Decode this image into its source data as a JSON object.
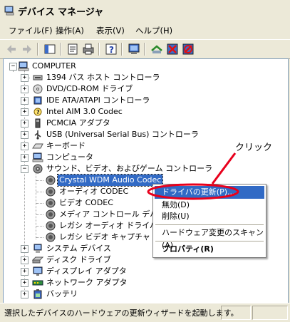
{
  "window": {
    "title": "デバイス マネージャ"
  },
  "menubar": [
    "ファイル(F)",
    "操作(A)",
    "表示(V)",
    "ヘルプ(H)"
  ],
  "toolbar": [
    "back-icon",
    "forward-icon",
    "console-tree-icon",
    "properties-icon",
    "print-icon",
    "help-icon",
    "scan-hardware-icon",
    "update-driver-icon",
    "uninstall-icon",
    "disable-icon"
  ],
  "tree": {
    "root": "COMPUTER",
    "items": [
      {
        "label": "1394 バス ホスト コントローラ",
        "icon": "1394-icon",
        "exp": "+"
      },
      {
        "label": "DVD/CD-ROM ドライブ",
        "icon": "cdrom-icon",
        "exp": "+"
      },
      {
        "label": "IDE ATA/ATAPI コントローラ",
        "icon": "ide-icon",
        "exp": "+"
      },
      {
        "label": "Intel AIM 3.0 Codec",
        "icon": "device-icon",
        "exp": "+"
      },
      {
        "label": "PCMCIA アダプタ",
        "icon": "pcmcia-icon",
        "exp": "+"
      },
      {
        "label": "USB (Universal Serial Bus) コントローラ",
        "icon": "usb-icon",
        "exp": "+"
      },
      {
        "label": "キーボード",
        "icon": "keyboard-icon",
        "exp": "+"
      },
      {
        "label": "コンピュータ",
        "icon": "computer-icon",
        "exp": "+"
      },
      {
        "label": "サウンド、ビデオ、およびゲーム コントローラ",
        "icon": "sound-icon",
        "exp": "-"
      }
    ],
    "sound_children": [
      {
        "label": "Crystal WDM Audio Codec",
        "selected": true
      },
      {
        "label": "オーディオ CODEC"
      },
      {
        "label": "ビデオ CODEC"
      },
      {
        "label": "メディア コントロール デバイス"
      },
      {
        "label": "レガシ オーディオ ドライバ"
      },
      {
        "label": "レガシ ビデオ キャプチャ デバイス"
      }
    ],
    "after": [
      {
        "label": "システム デバイス",
        "icon": "system-icon",
        "exp": "+"
      },
      {
        "label": "ディスク ドライブ",
        "icon": "disk-icon",
        "exp": "+"
      },
      {
        "label": "ディスプレイ アダプタ",
        "icon": "display-icon",
        "exp": "+"
      },
      {
        "label": "ネットワーク アダプタ",
        "icon": "network-icon",
        "exp": "+"
      },
      {
        "label": "バッテリ",
        "icon": "battery-icon",
        "exp": "+"
      }
    ]
  },
  "context_menu": {
    "update": "ドライバの更新(P)...",
    "disable": "無効(D)",
    "uninstall": "削除(U)",
    "scan": "ハードウェア変更のスキャン(A)",
    "properties": "プロパティ(R)"
  },
  "annotation": "クリック",
  "status": "選択したデバイスのハードウェアの更新ウィザードを起動します。",
  "colors": {
    "selection": "#316ac5",
    "annotation": "#e8001c"
  }
}
